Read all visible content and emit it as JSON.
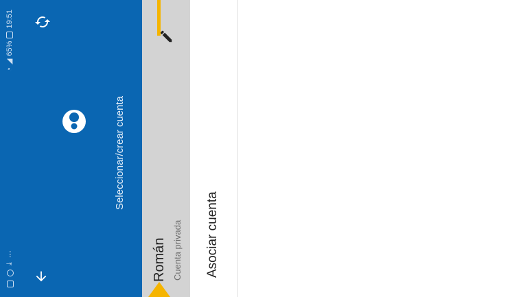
{
  "status_bar": {
    "time": "19:51",
    "battery": "65%"
  },
  "header": {
    "title": "Seleccionar/crear cuenta",
    "back_icon": "arrow-back-icon",
    "sync_icon": "sync-icon",
    "logo_icon": "app-logo-icon",
    "background_color": "#0a66b2"
  },
  "accounts": [
    {
      "name": "Román",
      "type": "Cuenta privada",
      "edit_icon": "pencil-icon"
    }
  ],
  "actions": {
    "link_account_label": "Asociar cuenta"
  },
  "annotations": {
    "marker_color": "#f5b400"
  }
}
